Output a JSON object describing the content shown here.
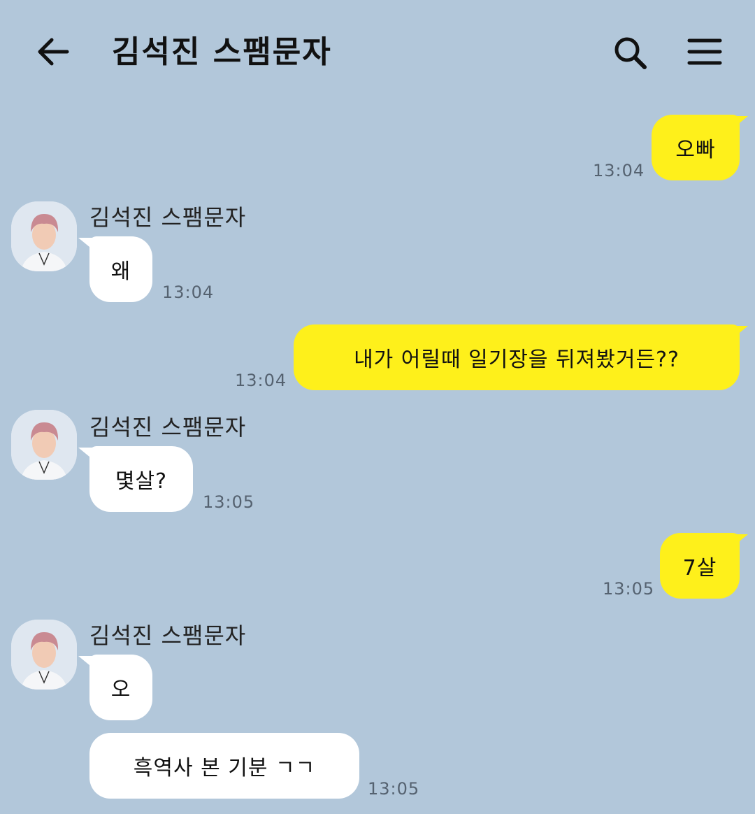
{
  "header": {
    "title": "김석진 스팸문자",
    "back_icon": "back-arrow-icon",
    "search_icon": "search-icon",
    "menu_icon": "menu-icon"
  },
  "colors": {
    "background": "#b2c7da",
    "my_bubble": "#fef01b",
    "other_bubble": "#ffffff"
  },
  "messages": [
    {
      "from": "me",
      "text": "오빠",
      "time": "13:04"
    },
    {
      "from": "other",
      "sender": "김석진 스팸문자",
      "text": "왜",
      "time": "13:04"
    },
    {
      "from": "me",
      "text": "내가 어릴때 일기장을 뒤져봤거든??",
      "time": "13:04"
    },
    {
      "from": "other",
      "sender": "김석진 스팸문자",
      "text": "몇살?",
      "time": "13:05"
    },
    {
      "from": "me",
      "text": "7살",
      "time": "13:05"
    },
    {
      "from": "other",
      "sender": "김석진 스팸문자",
      "text": "오",
      "time": ""
    },
    {
      "from": "other",
      "text": "흑역사 본 기분 ㄱㄱ",
      "time": "13:05"
    }
  ]
}
